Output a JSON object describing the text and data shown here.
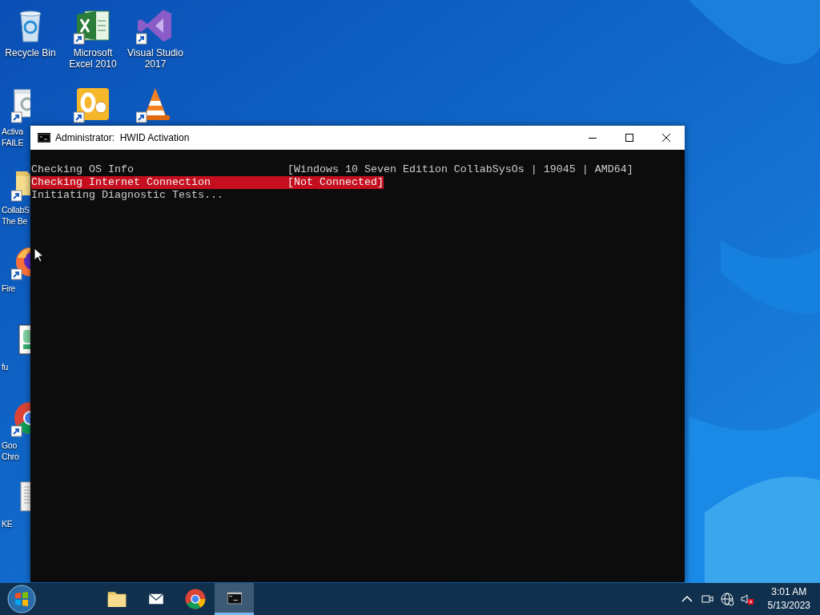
{
  "desktop": {
    "columns": [
      [
        {
          "kind": "recycle-bin",
          "shortcut": false,
          "covered": false,
          "label_lines": [
            "Recycle Bin"
          ]
        },
        {
          "kind": "gears",
          "shortcut": true,
          "covered": true,
          "label_lines": [
            "Activa",
            "FAILE"
          ]
        },
        {
          "kind": "folder",
          "shortcut": true,
          "covered": true,
          "label_lines": [
            "CollabS",
            "The Be"
          ]
        },
        {
          "kind": "firefox",
          "shortcut": true,
          "covered": true,
          "label_lines": [
            "Fire"
          ]
        },
        {
          "kind": "script",
          "shortcut": false,
          "covered": true,
          "label_lines": [
            "fu"
          ]
        },
        {
          "kind": "chrome",
          "shortcut": true,
          "covered": true,
          "label_lines": [
            "Goo",
            "Chro"
          ]
        },
        {
          "kind": "text-file",
          "shortcut": false,
          "covered": true,
          "label_lines": [
            "KE"
          ]
        }
      ],
      [
        {
          "kind": "excel",
          "shortcut": true,
          "covered": false,
          "label_lines": [
            "Microsoft",
            "Excel 2010"
          ]
        },
        {
          "kind": "outlook",
          "shortcut": true,
          "covered": false
        }
      ],
      [
        {
          "kind": "visual-studio",
          "shortcut": true,
          "covered": false,
          "label_lines": [
            "Visual Studio",
            "2017"
          ]
        },
        {
          "kind": "vlc",
          "shortcut": true,
          "covered": false
        }
      ]
    ]
  },
  "window": {
    "title": "Administrator:  HWID Activation",
    "lines": [
      {
        "left": "Checking OS Info",
        "right": "[Windows 10 Seven Edition CollabSysOs | 19045 | AMD64]",
        "highlight": false
      },
      {
        "left": "Checking Internet Connection",
        "right": "[Not Connected]",
        "highlight": true
      },
      {
        "left": "Initiating Diagnostic Tests...",
        "highlight": false
      }
    ]
  },
  "taskbar": {
    "apps": [
      {
        "kind": "folder",
        "selected": false
      },
      {
        "kind": "mail",
        "selected": false
      },
      {
        "kind": "chrome",
        "selected": false
      },
      {
        "kind": "console",
        "selected": true
      }
    ],
    "tray": {
      "time": "3:01 AM",
      "date": "5/13/2023"
    }
  }
}
